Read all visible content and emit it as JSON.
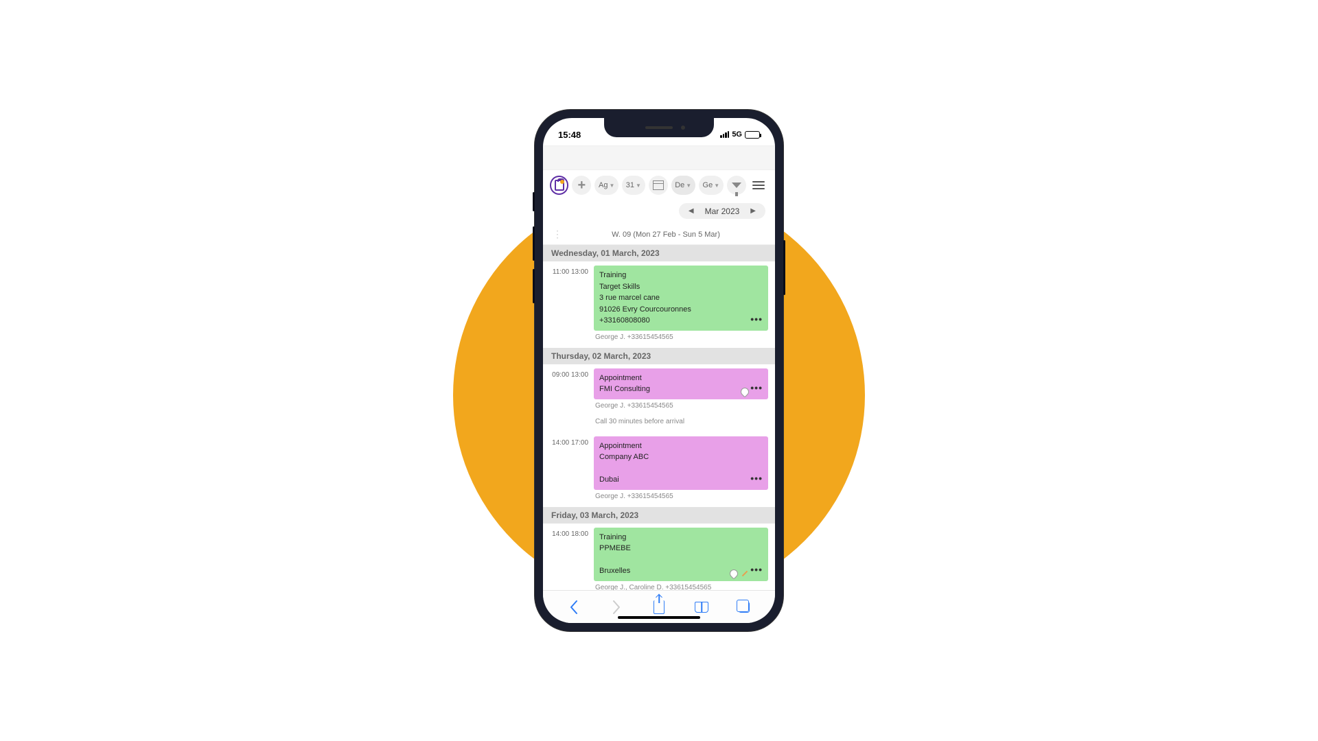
{
  "status": {
    "time": "15:48",
    "network": "5G"
  },
  "toolbar": {
    "buttons": {
      "ag": "Ag",
      "date": "31",
      "de": "De",
      "ge": "Ge"
    }
  },
  "monthNav": {
    "label": "Mar 2023"
  },
  "week": {
    "label": "W. 09 (Mon 27 Feb - Sun 5 Mar)"
  },
  "days": [
    {
      "header": "Wednesday, 01 March, 2023",
      "events": [
        {
          "time": "11:00 13:00",
          "color": "green",
          "lines": [
            "Training",
            "Target Skills",
            "3 rue marcel cane",
            "91026 Evry Courcouronnes",
            "+33160808080"
          ],
          "meta": [
            "George J. +33615454565"
          ],
          "hasBubble": false,
          "hasPencil": false
        }
      ]
    },
    {
      "header": "Thursday, 02 March, 2023",
      "events": [
        {
          "time": "09:00 13:00",
          "color": "pink",
          "lines": [
            "Appointment",
            "FMI Consulting"
          ],
          "meta": [
            "George J. +33615454565",
            "Call 30 minutes before arrival"
          ],
          "hasBubble": true,
          "hasPencil": false
        },
        {
          "time": "14:00 17:00",
          "color": "pink",
          "lines": [
            "Appointment",
            "Company ABC",
            "",
            "Dubai"
          ],
          "meta": [
            "George J. +33615454565"
          ],
          "hasBubble": false,
          "hasPencil": false
        }
      ]
    },
    {
      "header": "Friday, 03 March, 2023",
      "events": [
        {
          "time": "14:00 18:00",
          "color": "green",
          "lines": [
            "Training",
            "PPMEBE",
            "",
            "Bruxelles"
          ],
          "meta": [
            "George J., Caroline D. +33615454565"
          ],
          "hasBubble": true,
          "hasPencil": true
        }
      ]
    }
  ]
}
